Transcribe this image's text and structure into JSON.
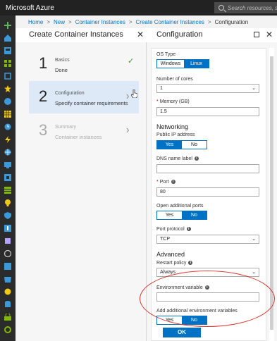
{
  "app": {
    "title": "Microsoft Azure"
  },
  "search": {
    "placeholder": "Search resources, se"
  },
  "breadcrumb": [
    "Home",
    "New",
    "Container Instances",
    "Create Container Instances",
    "Configuration"
  ],
  "wizard": {
    "title": "Create Container Instances",
    "steps": [
      {
        "number": "1",
        "title": "Basics",
        "subtitle": "Done",
        "state": "done"
      },
      {
        "number": "2",
        "title": "Configuration",
        "subtitle": "Specify container requirements",
        "state": "active"
      },
      {
        "number": "3",
        "title": "Summary",
        "subtitle": "Container instances",
        "state": "disabled"
      }
    ]
  },
  "config": {
    "title": "Configuration",
    "os_type": {
      "label": "OS Type",
      "options": [
        "Windows",
        "Linux"
      ],
      "selected": "Linux"
    },
    "cores": {
      "label": "Number of cores",
      "value": "1"
    },
    "memory": {
      "label": "Memory (GB)",
      "value": "1.5"
    },
    "networking": {
      "heading": "Networking"
    },
    "public_ip": {
      "label": "Public IP address",
      "options": [
        "Yes",
        "No"
      ],
      "selected": "Yes"
    },
    "dns": {
      "label": "DNS name label",
      "value": ""
    },
    "port": {
      "label": "Port",
      "value": "80"
    },
    "open_ports": {
      "label": "Open additional ports",
      "options": [
        "Yes",
        "No"
      ],
      "selected": "No"
    },
    "port_protocol": {
      "label": "Port protocol",
      "value": "TCP"
    },
    "advanced": {
      "heading": "Advanced"
    },
    "restart_policy": {
      "label": "Restart policy",
      "value": "Always"
    },
    "env_var": {
      "label": "Environment variable",
      "value": ""
    },
    "add_env": {
      "label": "Add additional environment variables",
      "options": [
        "Yes",
        "No"
      ],
      "selected": "No"
    },
    "ok_label": "OK"
  },
  "colors": {
    "accent": "#0072c6",
    "topbar": "#222222",
    "annotation": "#d9362f",
    "check": "#3c9b22"
  },
  "rail_icons": [
    "plus-icon",
    "home-icon",
    "dashboard-icon",
    "all-resources-icon",
    "resource-groups-icon",
    "favorites-icon",
    "app-services-icon",
    "sql-icon",
    "clock-icon",
    "function-icon",
    "globe-icon",
    "virtual-machines-icon",
    "key-vault-icon",
    "storage-icon",
    "monitor-icon",
    "security-icon",
    "help-icon",
    "cost-icon",
    "advisor-icon",
    "settings-icon"
  ],
  "glyphs": {
    "check": "✓",
    "chevron": "›",
    "close": "✕",
    "caret": "⌄",
    "info": "i",
    "required": "*"
  }
}
